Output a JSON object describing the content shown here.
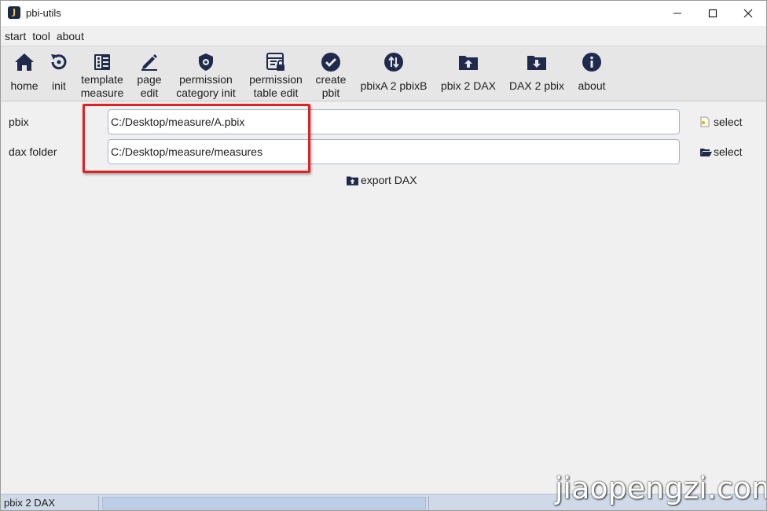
{
  "window": {
    "title": "pbi-utils",
    "app_icon_letter": "J"
  },
  "menu": [
    "start",
    "tool",
    "about"
  ],
  "toolbar": [
    {
      "label": "home",
      "icon": "home-icon"
    },
    {
      "label": "init",
      "icon": "refresh-icon"
    },
    {
      "label": "template\nmeasure",
      "icon": "template-icon"
    },
    {
      "label": "page\nedit",
      "icon": "pencil-icon"
    },
    {
      "label": "permission\ncategory init",
      "icon": "shield-gear-icon"
    },
    {
      "label": "permission\ntable edit",
      "icon": "table-lock-icon"
    },
    {
      "label": "create\npbit",
      "icon": "check-circle-icon"
    },
    {
      "label": "pbixA 2 pbixB",
      "icon": "swap-circle-icon"
    },
    {
      "label": "pbix 2 DAX",
      "icon": "folder-upload-icon"
    },
    {
      "label": "DAX 2 pbix",
      "icon": "folder-download-icon"
    },
    {
      "label": "about",
      "icon": "info-icon"
    }
  ],
  "form": {
    "pbix_label": "pbix",
    "pbix_value": "C:/Desktop/measure/A.pbix",
    "dax_label": "dax folder",
    "dax_value": "C:/Desktop/measure/measures",
    "select_label": "select",
    "export_label": "export DAX"
  },
  "status": {
    "text": "pbix 2 DAX"
  },
  "watermark": "jiaopengzi.com",
  "colors": {
    "icon": "#1f2a4d",
    "highlight": "#e02222",
    "statusbar": "#cfd9e8"
  }
}
